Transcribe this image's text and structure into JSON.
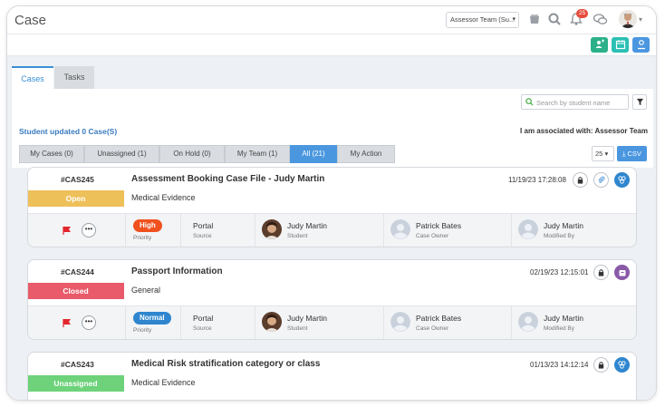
{
  "app": {
    "title": "Case"
  },
  "header": {
    "team_select": "Assessor Team (Su...",
    "notification_count": "25"
  },
  "colors": {
    "accent": "#3a8fd6",
    "open": "#eec05a",
    "closed": "#e95b6a",
    "unassigned": "#6dd27a",
    "high": "#f0511f",
    "normal": "#2f86cf",
    "green_btn": "#2bb08a"
  },
  "tabs": [
    {
      "label": "Cases",
      "active": true
    },
    {
      "label": "Tasks",
      "active": false
    }
  ],
  "search": {
    "placeholder": "Search by student name"
  },
  "summary": {
    "updated_text": "Student updated 0 Case(S)",
    "associated_text": "I am associated with: Assessor Team"
  },
  "filters": [
    {
      "label": "My Cases (0)"
    },
    {
      "label": "Unassigned (1)"
    },
    {
      "label": "On Hold (0)"
    },
    {
      "label": "My Team (1)"
    },
    {
      "label": "All (21)",
      "active": true
    },
    {
      "label": "My Action"
    }
  ],
  "page_size": "25",
  "csv_label": "CSV",
  "cases": [
    {
      "id": "#CAS245",
      "status": "Open",
      "title": "Assessment Booking Case File - Judy Martin",
      "category": "Medical Evidence",
      "date": "11/19/23 17:28:08",
      "priority": "High",
      "priority_label": "Priority",
      "source": "Portal",
      "source_label": "Source",
      "student": "Judy Martin",
      "student_label": "Student",
      "owner": "Patrick Bates",
      "owner_label": "Case Owner",
      "modified_by": "Judy Martin",
      "modified_label": "Modified By",
      "icons": [
        "lock-icon",
        "paperclip-icon",
        "portal-icon"
      ]
    },
    {
      "id": "#CAS244",
      "status": "Closed",
      "title": "Passport Information",
      "category": "General",
      "date": "02/19/23 12:15:01",
      "priority": "Normal",
      "priority_label": "Priority",
      "source": "Portal",
      "source_label": "Source",
      "student": "Judy Martin",
      "student_label": "Student",
      "owner": "Patrick Bates",
      "owner_label": "Case Owner",
      "modified_by": "Judy Martin",
      "modified_label": "Modified By",
      "icons": [
        "lock-icon",
        "box-icon"
      ]
    },
    {
      "id": "#CAS243",
      "status": "Unassigned",
      "title": "Medical Risk stratification category or class",
      "category": "Medical Evidence",
      "date": "01/13/23 14:12:14",
      "icons": [
        "lock-icon",
        "portal-icon"
      ]
    }
  ]
}
